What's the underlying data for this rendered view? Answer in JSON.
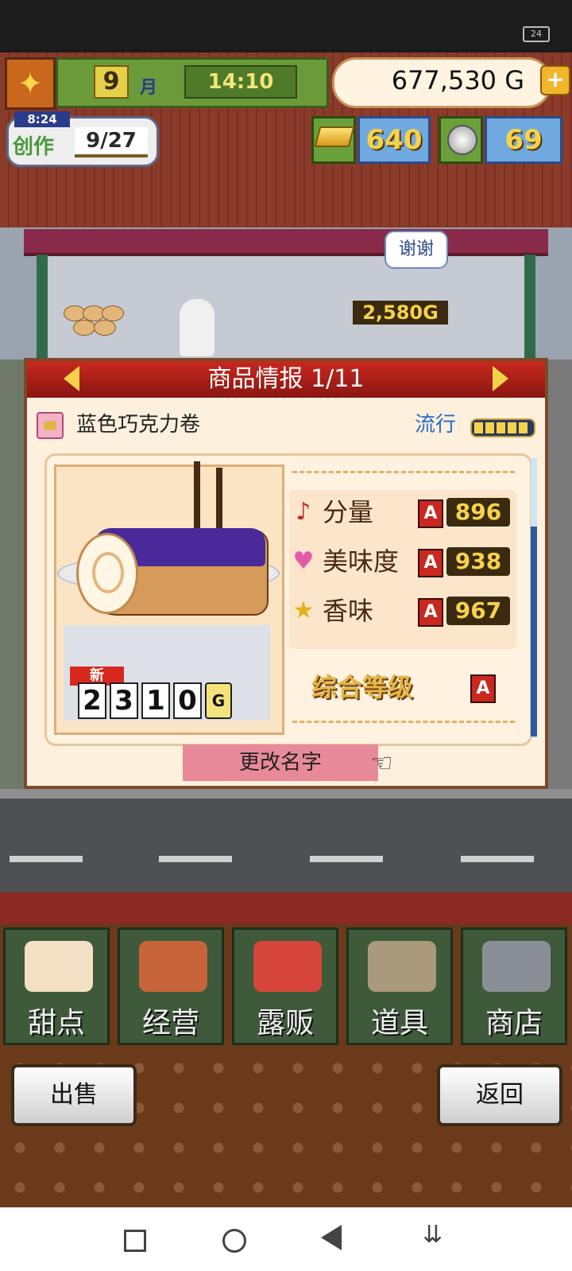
{
  "status_bar": {
    "battery": "24"
  },
  "hud": {
    "month": "9",
    "month_label": "月",
    "time": "14:10",
    "money": "677,530 G",
    "add_icon": "plus-icon",
    "create_label": "创作",
    "create_timer": "8:24",
    "create_count": "9/27",
    "gold_bars": "640",
    "medals": "69"
  },
  "scene": {
    "speech_bubble": "谢谢",
    "earned": "2,580G"
  },
  "dialog": {
    "title": "商品情报 1/11",
    "product_name": "蓝色巧克力卷",
    "popular_label": "流行",
    "popular_level": 5,
    "new_badge": "新",
    "price_digits": [
      "2",
      "3",
      "1",
      "0"
    ],
    "price_unit": "G",
    "stats": [
      {
        "icon": "music-note-icon",
        "label": "分量",
        "grade": "A",
        "value": "896"
      },
      {
        "icon": "heart-icon",
        "label": "美味度",
        "grade": "A",
        "value": "938"
      },
      {
        "icon": "star-icon",
        "label": "香味",
        "grade": "A",
        "value": "967"
      }
    ],
    "overall_label": "综合等级",
    "overall_grade": "A",
    "rename_button": "更改名字"
  },
  "nav": [
    {
      "label": "甜点",
      "icon": "cake-icon"
    },
    {
      "label": "经营",
      "icon": "shop-icon"
    },
    {
      "label": "露贩",
      "icon": "truck-icon"
    },
    {
      "label": "道具",
      "icon": "gear-bag-icon"
    },
    {
      "label": "商店",
      "icon": "cart-icon"
    }
  ],
  "bottom": {
    "sell_button": "出售",
    "back_button": "返回"
  },
  "colors": {
    "dialog_header": "#c8281e",
    "nav_button": "#3e5a3a",
    "popular_text": "#2a6ac8"
  }
}
